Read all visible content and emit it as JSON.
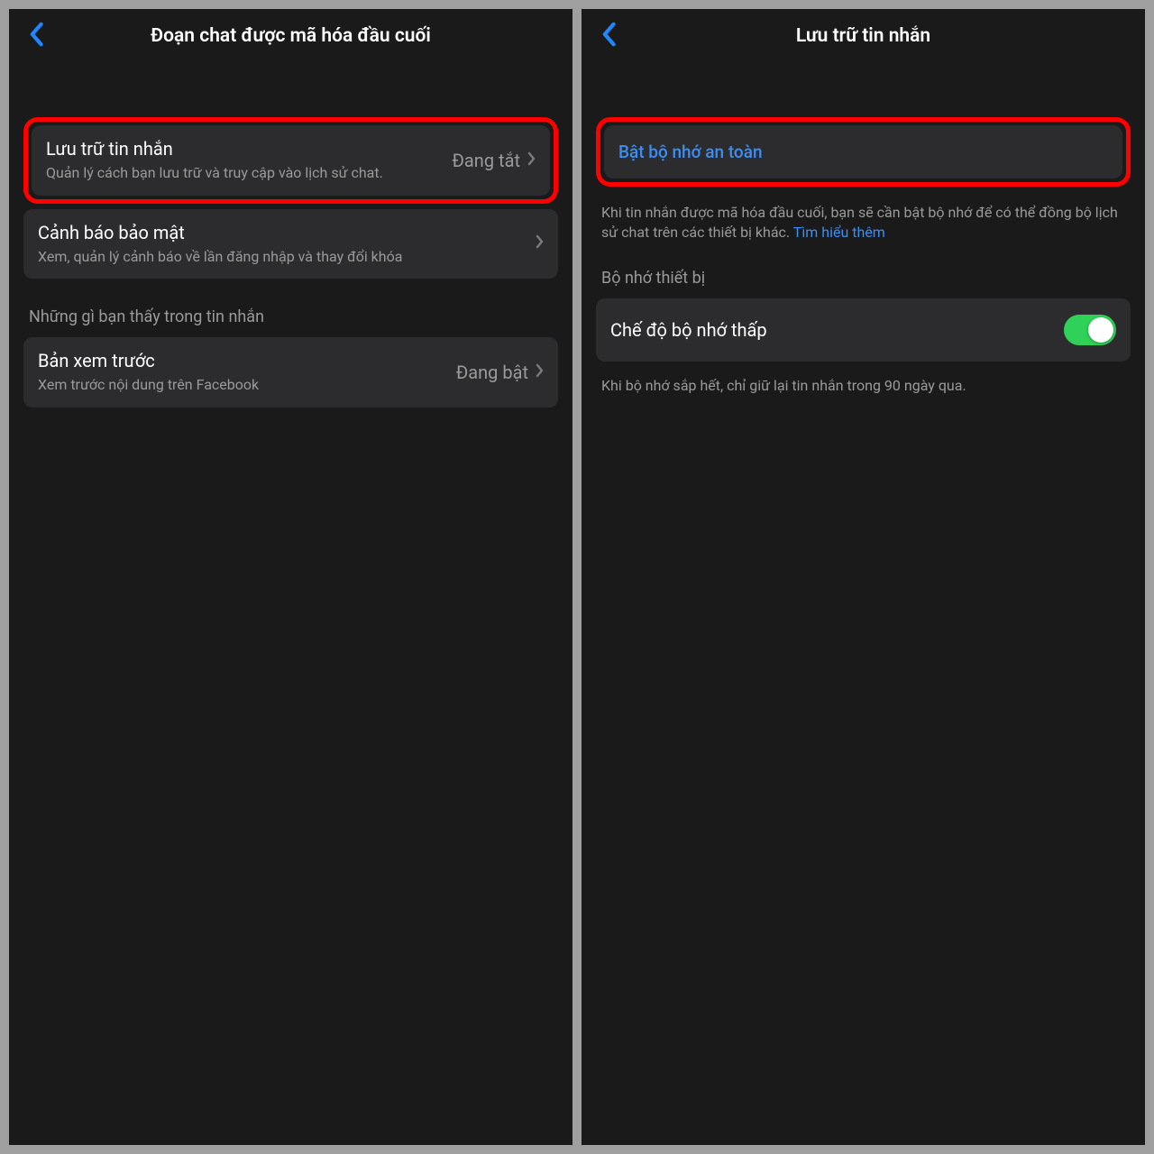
{
  "colors": {
    "accent_blue": "#3a8ff7",
    "highlight_red": "#ff0000",
    "toggle_green": "#30d158",
    "bg_dark": "#1a1a1a",
    "card_bg": "#2c2c2e"
  },
  "left_screen": {
    "header_title": "Đoạn chat được mã hóa đầu cuối",
    "row1": {
      "title": "Lưu trữ tin nhắn",
      "subtitle": "Quản lý cách bạn lưu trữ và truy cập vào lịch sử chat.",
      "value": "Đang tắt"
    },
    "row2": {
      "title": "Cảnh báo bảo mật",
      "subtitle": "Xem, quản lý cảnh báo về lần đăng nhập và thay đổi khóa"
    },
    "section_header": "Những gì bạn thấy trong tin nhắn",
    "row3": {
      "title": "Bản xem trước",
      "subtitle": "Xem trước nội dung trên Facebook",
      "value": "Đang bật"
    }
  },
  "right_screen": {
    "header_title": "Lưu trữ tin nhắn",
    "row1": {
      "title": "Bật bộ nhớ an toàn"
    },
    "footnote1_text": "Khi tin nhắn được mã hóa đầu cuối, bạn sẽ cần bật bộ nhớ để có thể đồng bộ lịch sử chat trên các thiết bị khác. ",
    "footnote1_link": "Tìm hiểu thêm",
    "section_header": "Bộ nhớ thiết bị",
    "row2": {
      "title": "Chế độ bộ nhớ thấp"
    },
    "footnote2": "Khi bộ nhớ sắp hết, chỉ giữ lại tin nhắn trong 90 ngày qua."
  }
}
